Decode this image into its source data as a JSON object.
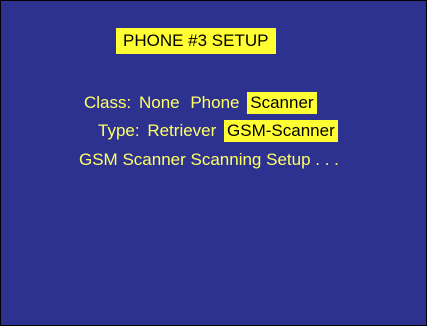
{
  "screen": {
    "title": "PHONE #3 SETUP"
  },
  "class_row": {
    "label": "Class:",
    "options": [
      "None",
      "Phone",
      "Scanner"
    ],
    "selected": "Scanner"
  },
  "type_row": {
    "label": "Type:",
    "options": [
      "Retriever",
      "GSM-Scanner"
    ],
    "selected": "GSM-Scanner"
  },
  "gsm_setup": {
    "label": "GSM Scanner Scanning Setup . . ."
  },
  "colors": {
    "background": "#2d3290",
    "text": "#ffff66",
    "highlight": "#ffff33",
    "highlight_text": "#000000"
  }
}
